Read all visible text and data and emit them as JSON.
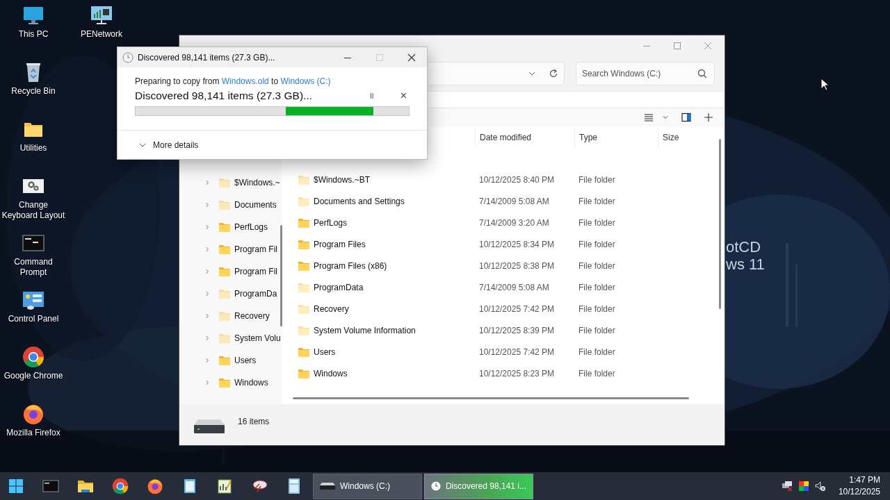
{
  "desktop_icons": [
    {
      "label": "This PC",
      "kind": "monitor"
    },
    {
      "label": "Recycle Bin",
      "kind": "bin"
    },
    {
      "label": "Utilities",
      "kind": "folder"
    },
    {
      "label": "Change Keyboard Layout",
      "kind": "gear"
    },
    {
      "label": "Command Prompt",
      "kind": "console"
    },
    {
      "label": "Control Panel",
      "kind": "panel"
    },
    {
      "label": "Google Chrome",
      "kind": "chrome"
    },
    {
      "label": "Mozilla Firefox",
      "kind": "firefox"
    }
  ],
  "desktop_icons_column_2": [
    {
      "label": "PENetwork",
      "kind": "network"
    }
  ],
  "wallpaper": {
    "lines": [
      "otCD",
      "ws 11"
    ]
  },
  "explorer": {
    "search": {
      "placeholder": "Search Windows (C:)"
    },
    "nav_tree": [
      {
        "label": "$Windows.~",
        "hidden": true,
        "expanded": false
      },
      {
        "label": "Documents",
        "hidden": true,
        "expanded": false
      },
      {
        "label": "PerfLogs",
        "hidden": false,
        "expanded": false
      },
      {
        "label": "Program Fil",
        "hidden": false,
        "expanded": false
      },
      {
        "label": "Program Fil",
        "hidden": false,
        "expanded": false
      },
      {
        "label": "ProgramDa",
        "hidden": true,
        "expanded": false
      },
      {
        "label": "Recovery",
        "hidden": true,
        "expanded": false
      },
      {
        "label": "System Volu",
        "hidden": true,
        "expanded": false
      },
      {
        "label": "Users",
        "hidden": false,
        "expanded": false
      },
      {
        "label": "Windows",
        "hidden": false,
        "expanded": false
      }
    ],
    "columns": [
      "Date modified",
      "Type",
      "Size"
    ],
    "rows": [
      {
        "name": "$Windows.~BT",
        "date": "10/12/2025 8:40 PM",
        "type": "File folder",
        "hidden": true
      },
      {
        "name": "Documents and Settings",
        "date": "7/14/2009 5:08 AM",
        "type": "File folder",
        "hidden": true
      },
      {
        "name": "PerfLogs",
        "date": "7/14/2009 3:20 AM",
        "type": "File folder",
        "hidden": false
      },
      {
        "name": "Program Files",
        "date": "10/12/2025 8:34 PM",
        "type": "File folder",
        "hidden": false
      },
      {
        "name": "Program Files (x86)",
        "date": "10/12/2025 8:38 PM",
        "type": "File folder",
        "hidden": false
      },
      {
        "name": "ProgramData",
        "date": "7/14/2009 5:08 AM",
        "type": "File folder",
        "hidden": true
      },
      {
        "name": "Recovery",
        "date": "10/12/2025 7:42 PM",
        "type": "File folder",
        "hidden": true
      },
      {
        "name": "System Volume Information",
        "date": "10/12/2025 8:39 PM",
        "type": "File folder",
        "hidden": true
      },
      {
        "name": "Users",
        "date": "10/12/2025 7:42 PM",
        "type": "File folder",
        "hidden": false
      },
      {
        "name": "Windows",
        "date": "10/12/2025 8:23 PM",
        "type": "File folder",
        "hidden": false
      }
    ],
    "status": "16 items"
  },
  "copy_dialog": {
    "title": "Discovered 98,141 items (27.3 GB)...",
    "preparing": {
      "before": "Preparing to copy from",
      "source": "Windows.old",
      "middle": "to",
      "destination": "Windows (C:)"
    },
    "headline": "Discovered 98,141 items (27.3 GB)...",
    "pause": "II",
    "cancel": "×",
    "more_details": "More details"
  },
  "taskbar": {
    "pinned": [
      {
        "kind": "start"
      },
      {
        "kind": "console"
      },
      {
        "kind": "folder"
      },
      {
        "kind": "chrome"
      },
      {
        "kind": "firefox"
      },
      {
        "kind": "notepad"
      },
      {
        "kind": "chart"
      },
      {
        "kind": "tool"
      },
      {
        "kind": "calculator"
      }
    ],
    "tasks": [
      {
        "label": "Windows (C:)",
        "kind": "drive",
        "selected": false
      },
      {
        "label": "Discovered 98,141 i...",
        "kind": "clock",
        "selected": true
      }
    ],
    "tray": [
      {
        "kind": "network"
      },
      {
        "kind": "colors"
      },
      {
        "kind": "speaker"
      }
    ],
    "time": "1:47 PM",
    "date": "10/12/2025"
  }
}
